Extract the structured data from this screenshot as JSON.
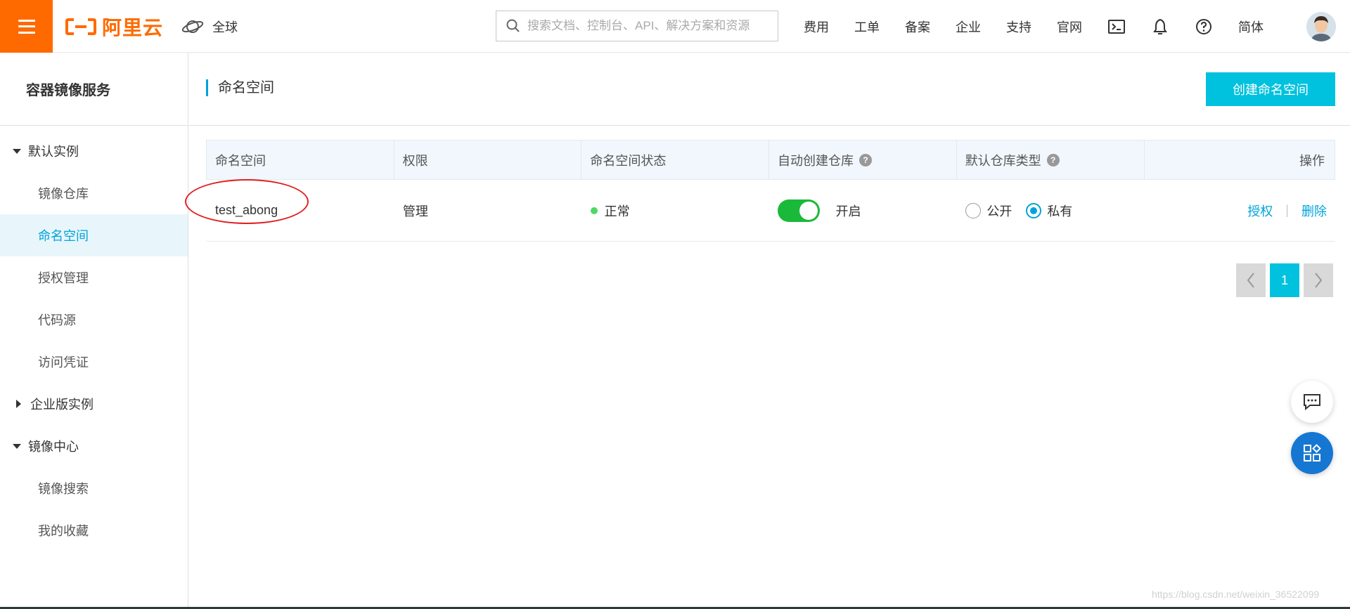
{
  "header": {
    "logo_text": "阿里云",
    "region_label": "全球",
    "search_placeholder": "搜索文档、控制台、API、解决方案和资源",
    "nav_items": [
      "费用",
      "工单",
      "备案",
      "企业",
      "支持",
      "官网"
    ],
    "lang_label": "简体",
    "brand_color": "#ff6a00"
  },
  "sidebar": {
    "title": "容器镜像服务",
    "groups": [
      {
        "label": "默认实例",
        "expanded": true,
        "items": [
          "镜像仓库",
          "命名空间",
          "授权管理",
          "代码源",
          "访问凭证"
        ]
      },
      {
        "label": "企业版实例",
        "expanded": false,
        "items": []
      },
      {
        "label": "镜像中心",
        "expanded": true,
        "items": [
          "镜像搜索",
          "我的收藏"
        ]
      }
    ],
    "active_item": "命名空间"
  },
  "main": {
    "title": "命名空间",
    "create_button": "创建命名空间",
    "table": {
      "headers": [
        "命名空间",
        "权限",
        "命名空间状态",
        "自动创建仓库",
        "默认仓库类型",
        "操作"
      ],
      "rows": [
        {
          "name": "test_abong",
          "permission": "管理",
          "status": "正常",
          "auto_create_label": "开启",
          "auto_create_on": true,
          "type_public": "公开",
          "type_private": "私有",
          "selected_type": "私有",
          "action_authorize": "授权",
          "action_delete": "删除"
        }
      ]
    },
    "pagination": {
      "current_page": "1"
    }
  },
  "watermark": "https://blog.csdn.net/weixin_36522099",
  "colors": {
    "accent": "#00c1de",
    "link": "#00a3d9",
    "switch_on": "#1ab93a",
    "status_ok": "#4cd964"
  }
}
